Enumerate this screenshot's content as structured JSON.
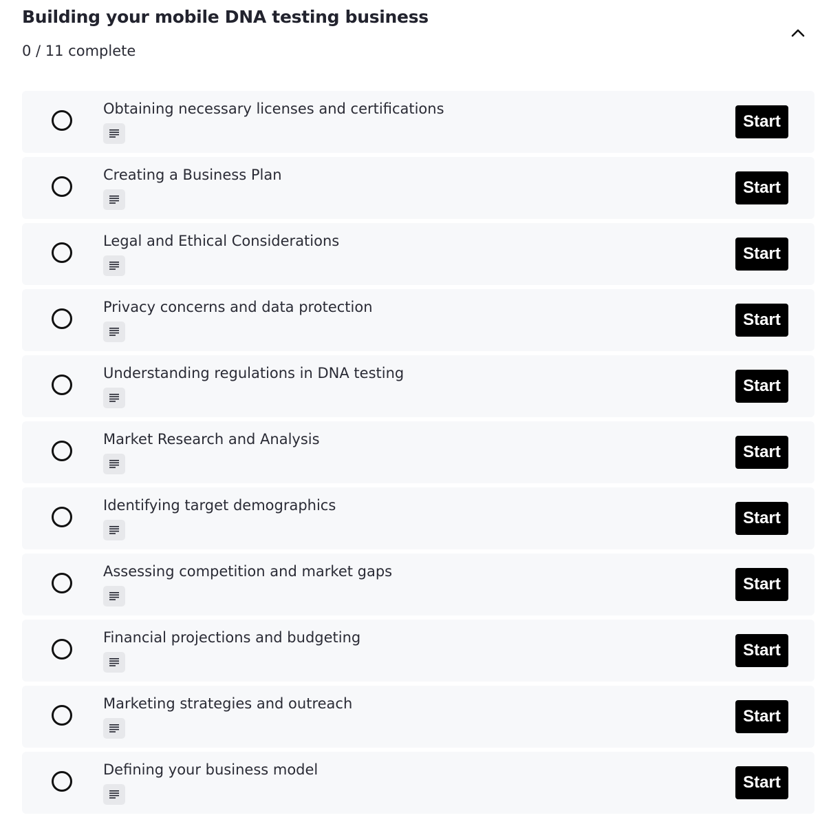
{
  "module": {
    "title": "Building your mobile DNA testing business",
    "progress": "0 / 11 complete",
    "completed": 0,
    "total": 11,
    "expanded": true,
    "toggle_icon": "chevron-up-icon"
  },
  "lessons": [
    {
      "title": "Obtaining necessary licenses and certifications",
      "type_icon": "text-lines-icon",
      "action_label": "Start",
      "completed": false
    },
    {
      "title": "Creating a Business Plan",
      "type_icon": "text-lines-icon",
      "action_label": "Start",
      "completed": false
    },
    {
      "title": "Legal and Ethical Considerations",
      "type_icon": "text-lines-icon",
      "action_label": "Start",
      "completed": false
    },
    {
      "title": "Privacy concerns and data protection",
      "type_icon": "text-lines-icon",
      "action_label": "Start",
      "completed": false
    },
    {
      "title": "Understanding regulations in DNA testing",
      "type_icon": "text-lines-icon",
      "action_label": "Start",
      "completed": false
    },
    {
      "title": "Market Research and Analysis",
      "type_icon": "text-lines-icon",
      "action_label": "Start",
      "completed": false
    },
    {
      "title": "Identifying target demographics",
      "type_icon": "text-lines-icon",
      "action_label": "Start",
      "completed": false
    },
    {
      "title": "Assessing competition and market gaps",
      "type_icon": "text-lines-icon",
      "action_label": "Start",
      "completed": false
    },
    {
      "title": "Financial projections and budgeting",
      "type_icon": "text-lines-icon",
      "action_label": "Start",
      "completed": false
    },
    {
      "title": "Marketing strategies and outreach",
      "type_icon": "text-lines-icon",
      "action_label": "Start",
      "completed": false
    },
    {
      "title": "Defining your business model",
      "type_icon": "text-lines-icon",
      "action_label": "Start",
      "completed": false
    }
  ],
  "colors": {
    "row_background": "#f7f8fa",
    "button_background": "#000000",
    "button_text": "#ffffff",
    "badge_background": "#e7e8eb",
    "text_primary": "#22232e"
  }
}
